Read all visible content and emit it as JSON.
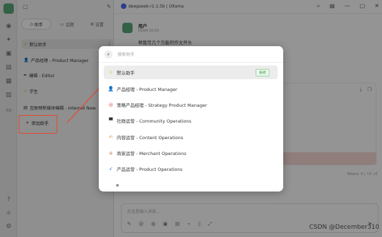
{
  "window": {
    "title": "deepseek-r1:1.5b | Ollama"
  },
  "panel": {
    "tabs": [
      {
        "label": "助手",
        "icon": "robot-icon"
      },
      {
        "label": "话题",
        "icon": "chat-icon"
      },
      {
        "label": "设置",
        "icon": "gear-icon"
      }
    ],
    "assistants": [
      {
        "label": "默认助手",
        "icon": "star-icon",
        "count": "1"
      },
      {
        "label": "产品经理 - Product Manager",
        "icon": "person-icon"
      },
      {
        "label": "编辑 - Editor",
        "icon": "pen-icon"
      },
      {
        "label": "学生",
        "icon": "star-icon"
      },
      {
        "label": "互联网新媒体编辑 - Internet New",
        "icon": "news-icon"
      }
    ],
    "add_label": "添加助手"
  },
  "chat": {
    "user_name": "用户",
    "time": "05/04 10:01",
    "message": "帮我写几个万能的作文开头",
    "tokens": "Tokens: 0 | ↑0 ↓0",
    "input_placeholder": "在这里输入消息..."
  },
  "modal": {
    "search_placeholder": "搜索助手",
    "items": [
      {
        "label": "默认助手",
        "icon": "star-icon",
        "badge": "系统"
      },
      {
        "label": "产品经理 - Product Manager",
        "icon": "person-icon"
      },
      {
        "label": "策略产品经理 - Strategy Product Manager",
        "icon": "target-icon"
      },
      {
        "label": "社群运营 - Community Operations",
        "icon": "hat-icon"
      },
      {
        "label": "内容运营 - Content Operations",
        "icon": "writing-hand-icon"
      },
      {
        "label": "商家运营 - Merchant Operations",
        "icon": "shop-icon"
      },
      {
        "label": "产品运营 - Product Operations",
        "icon": "rocket-icon"
      }
    ]
  },
  "watermark": "CSDN @December310",
  "colors": {
    "accent_green": "#58a877",
    "highlight_red": "#e8472e",
    "badge_green": "#3a9a4b"
  }
}
